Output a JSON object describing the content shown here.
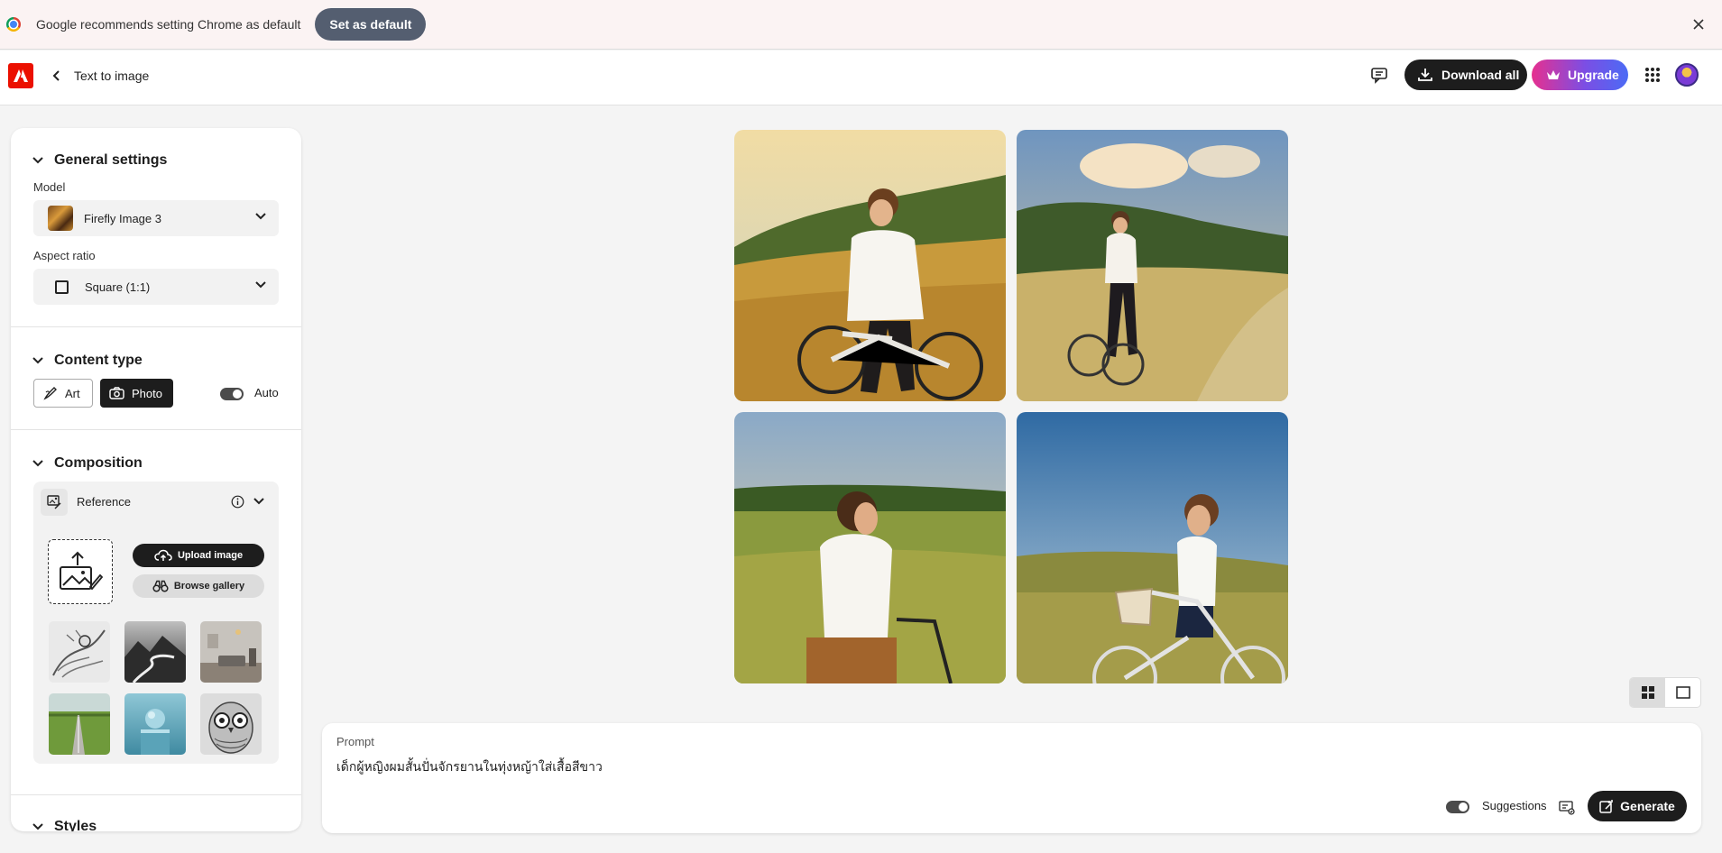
{
  "infobar": {
    "message": "Google recommends setting Chrome as default",
    "set_default_label": "Set as default"
  },
  "header": {
    "page_title": "Text to image",
    "download_all_label": "Download all",
    "upgrade_label": "Upgrade"
  },
  "sidebar": {
    "general_settings": {
      "title": "General settings",
      "model_label": "Model",
      "model_value": "Firefly Image 3",
      "aspect_label": "Aspect ratio",
      "aspect_value": "Square (1:1)"
    },
    "content_type": {
      "title": "Content type",
      "art_label": "Art",
      "photo_label": "Photo",
      "selected": "Photo",
      "auto_label": "Auto",
      "auto_on": true
    },
    "composition": {
      "title": "Composition",
      "reference_label": "Reference",
      "upload_label": "Upload image",
      "browse_label": "Browse gallery"
    },
    "styles": {
      "title": "Styles"
    }
  },
  "prompt": {
    "label": "Prompt",
    "text": "เด็กผู้หญิงผมสั้นปั่นจักรยานในทุ่งหญ้าใส่เสื้อสีขาว",
    "suggestions_label": "Suggestions",
    "suggestions_on": true,
    "generate_label": "Generate"
  },
  "icons": [
    "chrome-icon",
    "close-icon",
    "adobe-logo-icon",
    "chevron-left-icon",
    "feedback-icon",
    "download-icon",
    "crown-icon",
    "apps-grid-icon",
    "chevron-down-icon",
    "brush-icon",
    "camera-icon",
    "reference-icon",
    "info-icon",
    "image-upload-icon",
    "cloud-upload-icon",
    "binoculars-icon",
    "grid-view-icon",
    "single-view-icon",
    "generate-icon"
  ],
  "colors": {
    "adobe_red": "#eb1000",
    "dark": "#1d1d1d",
    "upgrade_gradient": [
      "#e6308f",
      "#7c4ee4",
      "#4b6bf5"
    ]
  }
}
